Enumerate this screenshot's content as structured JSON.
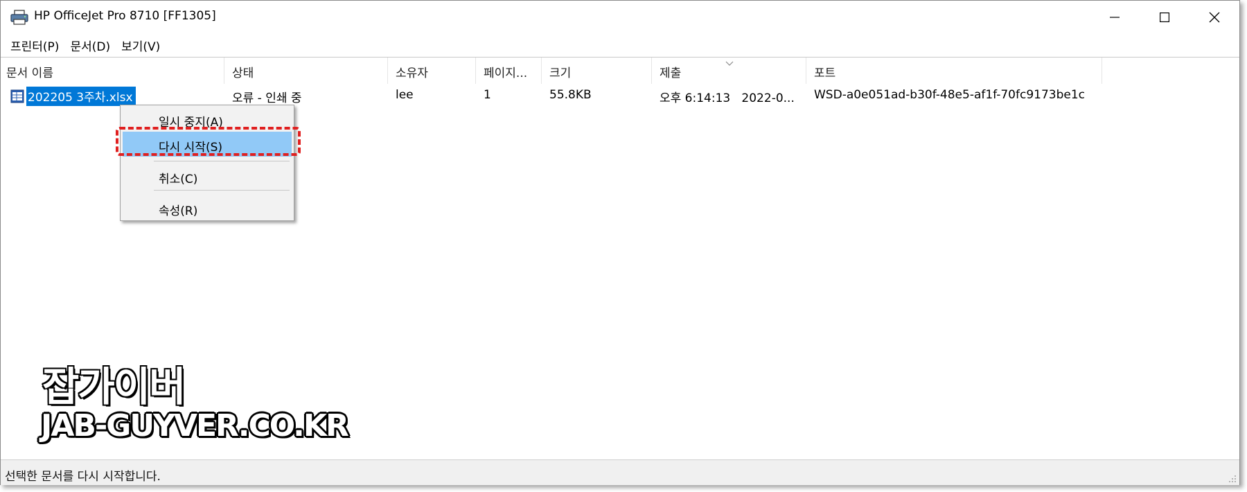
{
  "window": {
    "title": "HP OfficeJet Pro 8710 [FF1305]",
    "icon": "printer-icon",
    "controls": [
      "minimize-icon",
      "maximize-icon",
      "close-icon"
    ]
  },
  "menu": [
    {
      "label": "프린터(P)"
    },
    {
      "label": "문서(D)"
    },
    {
      "label": "보기(V)"
    }
  ],
  "columns": [
    "문서 이름",
    "상태",
    "소유자",
    "페이지...",
    "크기",
    "제출",
    "포트"
  ],
  "sort_indicator": "chevron-down-icon",
  "rows": [
    {
      "icon": "excel-file-icon",
      "name": "202205 3주차.xlsx",
      "status": "오류 - 인쇄 중",
      "owner": "lee",
      "pages": "1",
      "size": "55.8KB",
      "submitted": "오후 6:14:13   2022-0...",
      "port": "WSD-a0e051ad-b30f-48e5-af1f-70fc9173be1c"
    }
  ],
  "context_menu": {
    "items": [
      {
        "label": "일시 중지(A)"
      },
      {
        "label": "다시 시작(S)"
      },
      {
        "label": "취소(C)"
      },
      {
        "label": "속성(R)"
      }
    ],
    "highlighted_color": "#91c9f7",
    "callout_color": "#e02020"
  },
  "watermark": {
    "line1": "잡가이버",
    "line2": "JAB-GUYVER.CO.KR"
  },
  "status_bar": {
    "text": "선택한 문서를 다시 시작합니다."
  },
  "colors": {
    "selection": "#0078d7",
    "background": "#ffffff"
  }
}
